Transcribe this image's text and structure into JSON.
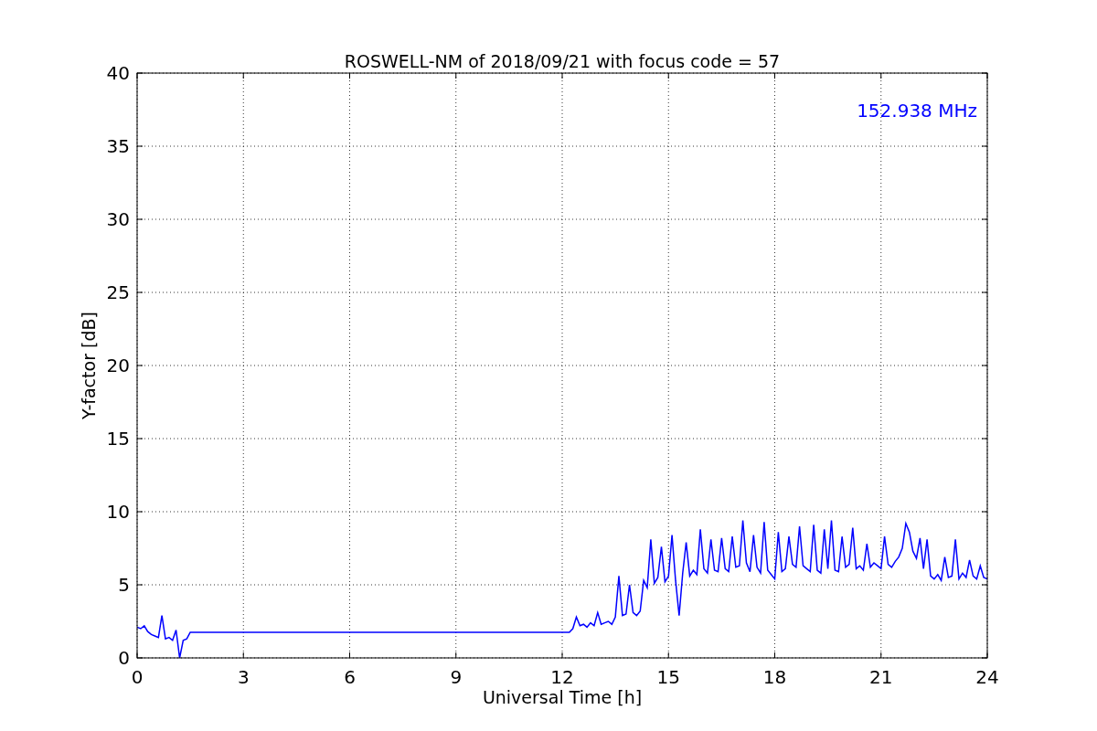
{
  "chart_data": {
    "type": "line",
    "title": "ROSWELL-NM of 2018/09/21 with focus code = 57",
    "xlabel": "Universal Time [h]",
    "ylabel": "Y-factor [dB]",
    "x": [
      0,
      0.1,
      0.2,
      0.3,
      0.4,
      0.5,
      0.6,
      0.7,
      0.8,
      0.9,
      1.0,
      1.1,
      1.2,
      1.3,
      1.4,
      1.5,
      12.2,
      12.3,
      12.4,
      12.5,
      12.6,
      12.7,
      12.8,
      12.9,
      13.0,
      13.1,
      13.2,
      13.3,
      13.4,
      13.5,
      13.6,
      13.7,
      13.8,
      13.9,
      14.0,
      14.1,
      14.2,
      14.3,
      14.4,
      14.5,
      14.6,
      14.7,
      14.8,
      14.9,
      15.0,
      15.1,
      15.2,
      15.3,
      15.4,
      15.5,
      15.6,
      15.7,
      15.8,
      15.9,
      16.0,
      16.1,
      16.2,
      16.3,
      16.4,
      16.5,
      16.6,
      16.7,
      16.8,
      16.9,
      17.0,
      17.1,
      17.2,
      17.3,
      17.4,
      17.5,
      17.6,
      17.7,
      17.8,
      17.9,
      18.0,
      18.1,
      18.2,
      18.3,
      18.4,
      18.5,
      18.6,
      18.7,
      18.8,
      18.9,
      19.0,
      19.1,
      19.2,
      19.3,
      19.4,
      19.5,
      19.6,
      19.7,
      19.8,
      19.9,
      20.0,
      20.1,
      20.2,
      20.3,
      20.4,
      20.5,
      20.6,
      20.7,
      20.8,
      20.9,
      21.0,
      21.1,
      21.2,
      21.3,
      21.4,
      21.5,
      21.6,
      21.7,
      21.8,
      21.9,
      22.0,
      22.1,
      22.2,
      22.3,
      22.4,
      22.5,
      22.6,
      22.7,
      22.8,
      22.9,
      23.0,
      23.1,
      23.2,
      23.3,
      23.4,
      23.5,
      23.6,
      23.7,
      23.8,
      23.9,
      24.0
    ],
    "series": [
      {
        "color": "#0000ff",
        "values": [
          2.1,
          2.0,
          2.2,
          1.8,
          1.6,
          1.5,
          1.4,
          2.9,
          1.3,
          1.4,
          1.2,
          1.9,
          0.0,
          1.2,
          1.3,
          1.75,
          1.75,
          2.0,
          2.8,
          2.2,
          2.3,
          2.1,
          2.4,
          2.2,
          3.1,
          2.3,
          2.4,
          2.5,
          2.3,
          2.8,
          5.6,
          2.9,
          3.0,
          5.0,
          3.1,
          2.9,
          3.2,
          5.3,
          4.8,
          8.1,
          5.1,
          5.5,
          7.6,
          5.2,
          5.6,
          8.4,
          5.3,
          2.9,
          5.8,
          7.9,
          5.6,
          6.0,
          5.7,
          8.8,
          6.1,
          5.8,
          8.1,
          6.0,
          5.9,
          8.2,
          6.1,
          5.9,
          8.3,
          6.2,
          6.3,
          9.4,
          6.5,
          5.9,
          8.4,
          6.2,
          5.8,
          9.3,
          6.0,
          5.7,
          5.4,
          8.6,
          5.9,
          6.1,
          8.3,
          6.4,
          6.2,
          9.0,
          6.3,
          6.1,
          5.9,
          9.1,
          6.0,
          5.8,
          8.8,
          6.1,
          9.4,
          6.0,
          5.9,
          8.3,
          6.2,
          6.4,
          8.9,
          6.1,
          6.3,
          6.0,
          7.8,
          6.2,
          6.5,
          6.3,
          6.1,
          8.3,
          6.4,
          6.2,
          6.6,
          6.9,
          7.5,
          9.2,
          8.6,
          7.3,
          6.8,
          8.2,
          6.1,
          8.1,
          5.6,
          5.4,
          5.7,
          5.3,
          6.9,
          5.5,
          5.6,
          8.1,
          5.4,
          5.8,
          5.5,
          6.7,
          5.6,
          5.4,
          6.3,
          5.5,
          5.4
        ]
      }
    ],
    "xlim": [
      0,
      24
    ],
    "ylim": [
      0,
      40
    ],
    "xticks": [
      0,
      3,
      6,
      9,
      12,
      15,
      18,
      21,
      24
    ],
    "yticks": [
      0,
      5,
      10,
      15,
      20,
      25,
      30,
      35,
      40
    ],
    "grid": true,
    "annotations": [
      {
        "text": "152.938 MHz"
      }
    ]
  }
}
